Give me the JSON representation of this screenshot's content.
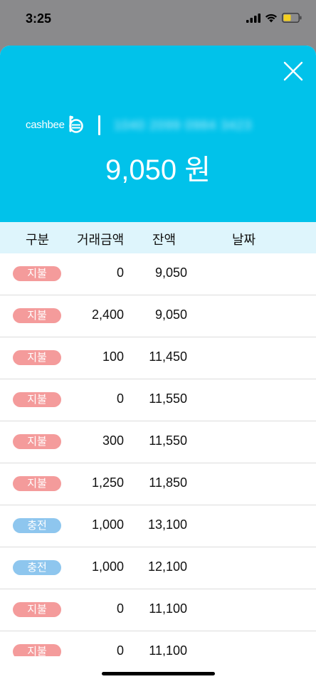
{
  "status_bar": {
    "time": "3:25",
    "battery_color": "#f5d020"
  },
  "header": {
    "background": "#01c2ea",
    "logo_text": "cashbee",
    "card_number": "1040 2099 0984 3423",
    "balance": "9,050 원"
  },
  "columns": {
    "type": "구분",
    "amount": "거래금액",
    "balance": "잔액",
    "date": "날짜"
  },
  "badge_colors": {
    "지불": "#f49b9b",
    "충전": "#8ec6ee"
  },
  "transactions": [
    {
      "type": "지불",
      "amount": "0",
      "balance": "9,050",
      "date": ""
    },
    {
      "type": "지불",
      "amount": "2,400",
      "balance": "9,050",
      "date": ""
    },
    {
      "type": "지불",
      "amount": "100",
      "balance": "11,450",
      "date": ""
    },
    {
      "type": "지불",
      "amount": "0",
      "balance": "11,550",
      "date": ""
    },
    {
      "type": "지불",
      "amount": "300",
      "balance": "11,550",
      "date": ""
    },
    {
      "type": "지불",
      "amount": "1,250",
      "balance": "11,850",
      "date": ""
    },
    {
      "type": "충전",
      "amount": "1,000",
      "balance": "13,100",
      "date": ""
    },
    {
      "type": "충전",
      "amount": "1,000",
      "balance": "12,100",
      "date": ""
    },
    {
      "type": "지불",
      "amount": "0",
      "balance": "11,100",
      "date": ""
    },
    {
      "type": "지불",
      "amount": "0",
      "balance": "11,100",
      "date": ""
    }
  ]
}
